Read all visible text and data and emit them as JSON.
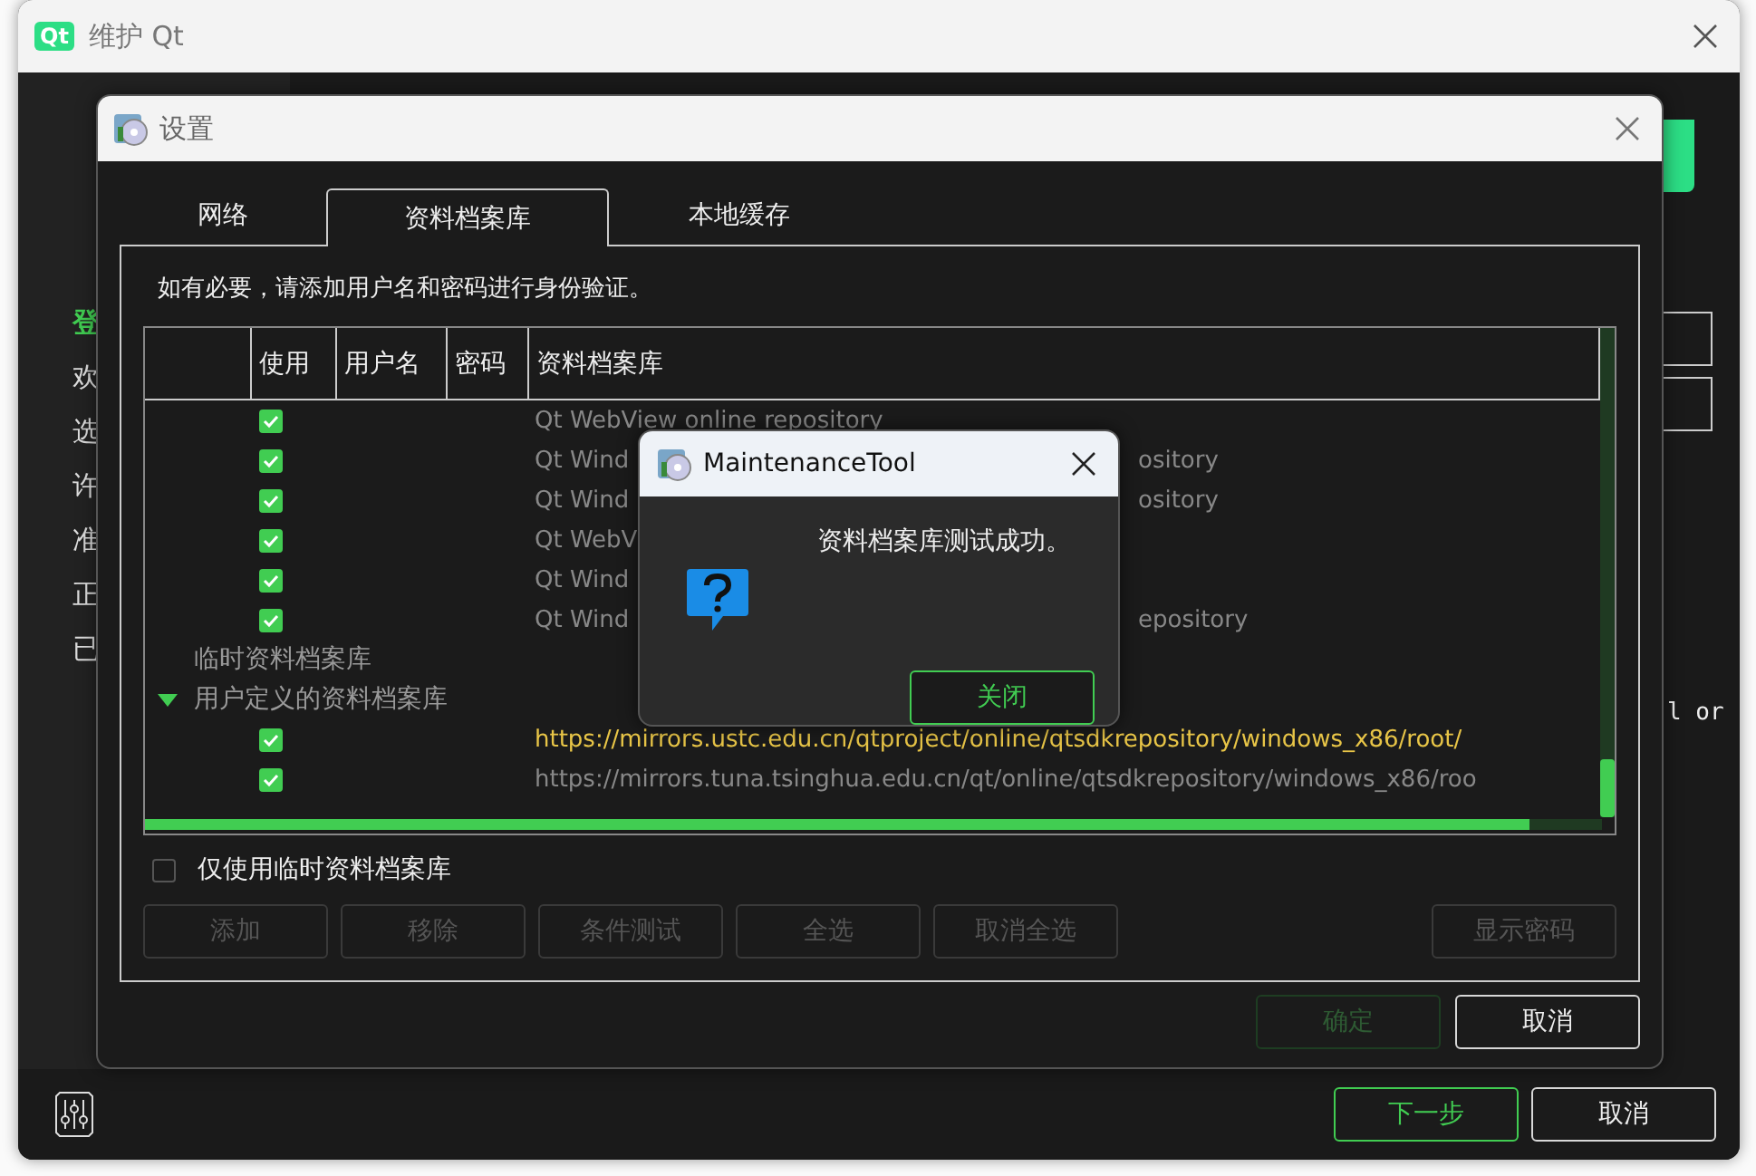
{
  "main_window": {
    "logo": "Qt",
    "title": "维护 Qt",
    "sidebar": [
      {
        "label": "登",
        "selected": true
      },
      {
        "label": "欢",
        "selected": false
      },
      {
        "label": "选",
        "selected": false
      },
      {
        "label": "许",
        "selected": false
      },
      {
        "label": "准",
        "selected": false
      },
      {
        "label": "正",
        "selected": false
      },
      {
        "label": "已",
        "selected": false
      }
    ],
    "side_text": "l or",
    "buttons": [
      {
        "label": "下一步",
        "kind": "primary"
      },
      {
        "label": "取消",
        "kind": "normal"
      }
    ]
  },
  "settings_dialog": {
    "title": "设置",
    "tabs": [
      {
        "label": "网络",
        "selected": false
      },
      {
        "label": "资料档案库",
        "selected": true
      },
      {
        "label": "本地缓存",
        "selected": false
      }
    ],
    "hint": "如有必要，请添加用户名和密码进行身份验证。",
    "table": {
      "columns": [
        "使用",
        "用户名",
        "密码",
        "资料档案库"
      ],
      "rows": [
        {
          "kind": "repo",
          "checked": true,
          "text": "Qt WebView online repository"
        },
        {
          "kind": "repo",
          "checked": true,
          "text": "Qt Wind",
          "text_right": "ository"
        },
        {
          "kind": "repo",
          "checked": true,
          "text": "Qt Wind",
          "text_right": "ository"
        },
        {
          "kind": "repo",
          "checked": true,
          "text": "Qt WebV"
        },
        {
          "kind": "repo",
          "checked": true,
          "text": "Qt Wind"
        },
        {
          "kind": "repo",
          "checked": true,
          "text": "Qt Wind",
          "text_right": "epository"
        },
        {
          "kind": "group",
          "label": "临时资料档案库"
        },
        {
          "kind": "group",
          "label": "用户定义的资料档案库",
          "expanded": true
        },
        {
          "kind": "url",
          "checked": true,
          "highlighted": true,
          "text": "https://mirrors.ustc.edu.cn/qtproject/online/qtsdkrepository/windows_x86/root/"
        },
        {
          "kind": "url",
          "checked": true,
          "highlighted": false,
          "text": "https://mirrors.tuna.tsinghua.edu.cn/qt/online/qtsdkrepository/windows_x86/roo"
        }
      ]
    },
    "temp_only": {
      "label": "仅使用临时资料档案库",
      "checked": false
    },
    "buttons": [
      {
        "label": "添加",
        "disabled": true
      },
      {
        "label": "移除",
        "disabled": true
      },
      {
        "label": "条件测试",
        "disabled": true
      },
      {
        "label": "全选",
        "disabled": true
      },
      {
        "label": "取消全选",
        "disabled": true
      }
    ],
    "show_password": {
      "label": "显示密码",
      "disabled": true
    },
    "footer": [
      {
        "label": "确定",
        "disabled": true
      },
      {
        "label": "取消",
        "disabled": false
      }
    ]
  },
  "message_box": {
    "title": "MaintenanceTool",
    "message": "资料档案库测试成功。",
    "button": "关闭"
  }
}
